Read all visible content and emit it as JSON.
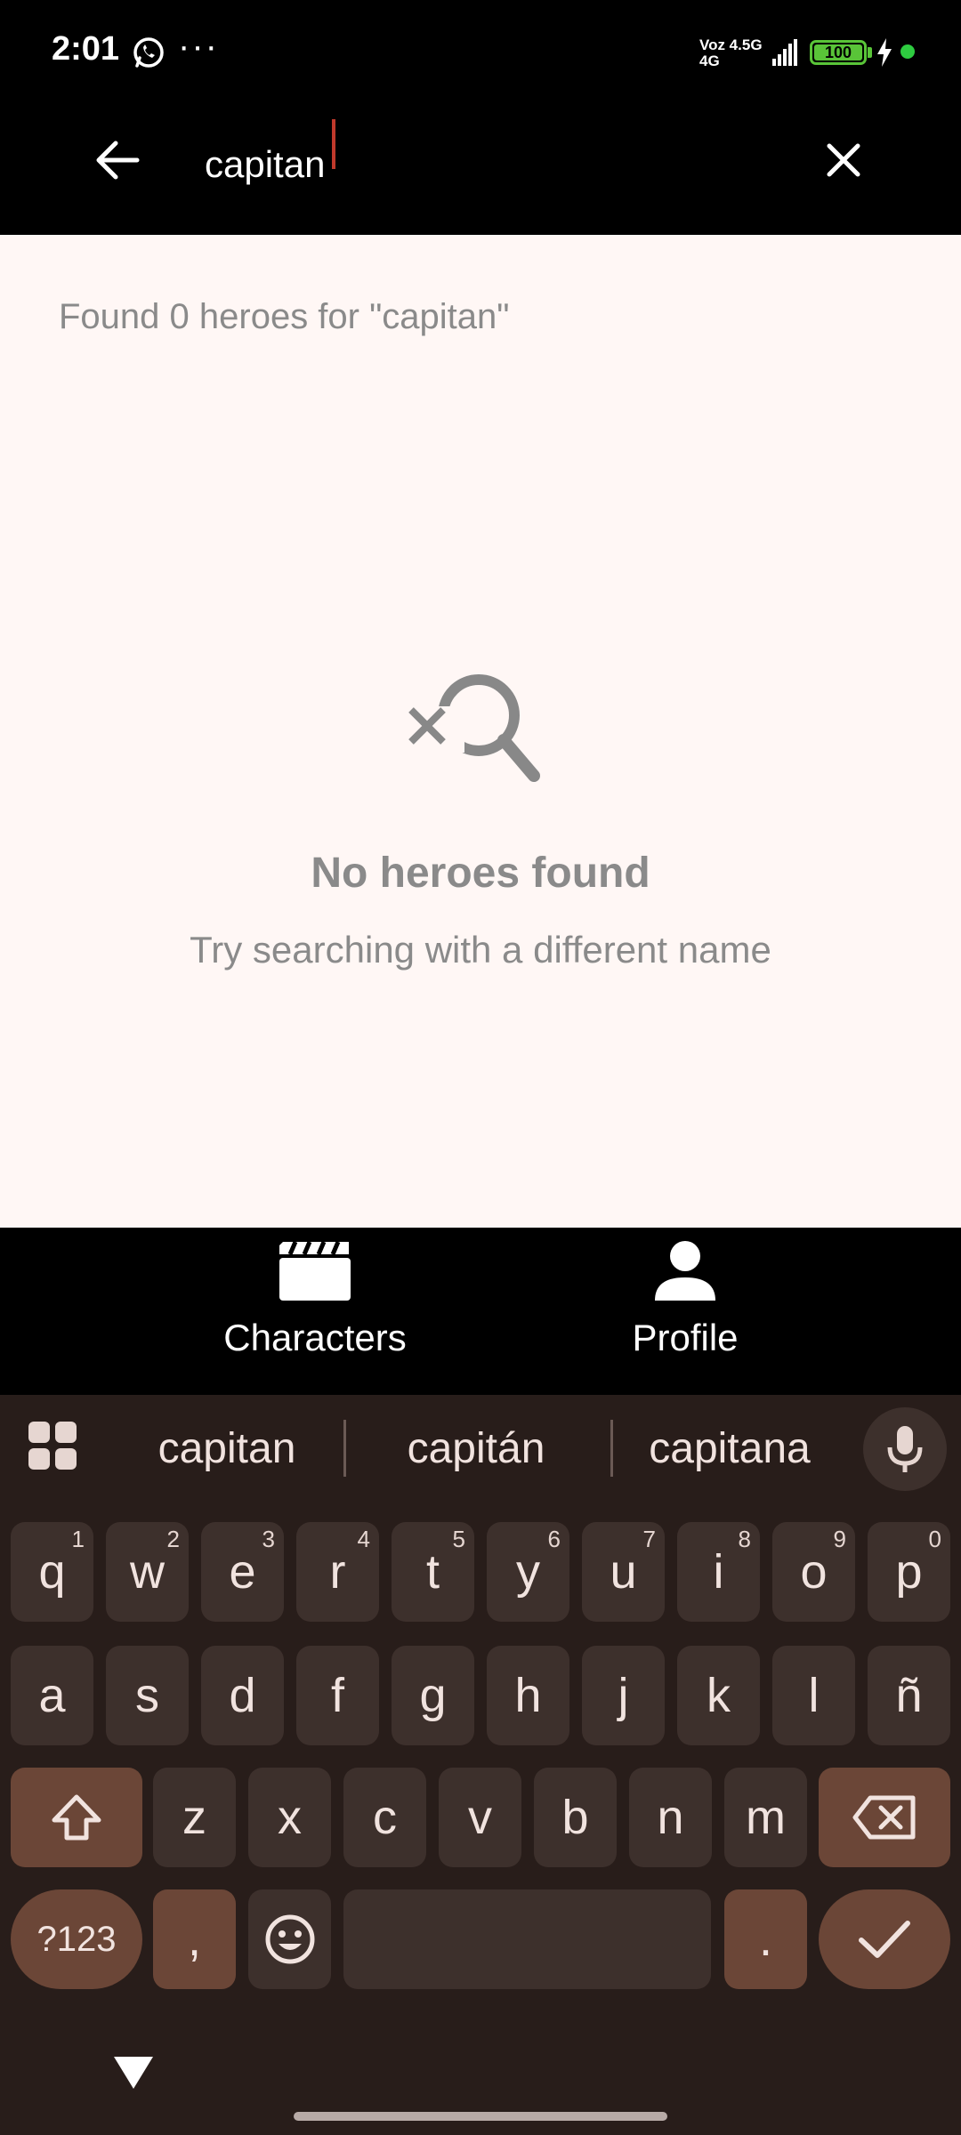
{
  "status_bar": {
    "time": "2:01",
    "dots": "···",
    "net_top": "Voz 4.5G",
    "net_bottom": "4G",
    "battery": "100"
  },
  "search": {
    "value": "capitan"
  },
  "results": {
    "count_text": "Found 0 heroes for \"capitan\"",
    "empty_title": "No heroes found",
    "empty_subtitle": "Try searching with a different name"
  },
  "bottom_nav": {
    "items": [
      {
        "label": "Characters",
        "icon": "clapperboard-icon"
      },
      {
        "label": "Profile",
        "icon": "person-icon"
      }
    ]
  },
  "keyboard": {
    "suggestions": [
      "capitan",
      "capitán",
      "capitana"
    ],
    "row1": [
      {
        "key": "q",
        "sup": "1"
      },
      {
        "key": "w",
        "sup": "2"
      },
      {
        "key": "e",
        "sup": "3"
      },
      {
        "key": "r",
        "sup": "4"
      },
      {
        "key": "t",
        "sup": "5"
      },
      {
        "key": "y",
        "sup": "6"
      },
      {
        "key": "u",
        "sup": "7"
      },
      {
        "key": "i",
        "sup": "8"
      },
      {
        "key": "o",
        "sup": "9"
      },
      {
        "key": "p",
        "sup": "0"
      }
    ],
    "row2": [
      "a",
      "s",
      "d",
      "f",
      "g",
      "h",
      "j",
      "k",
      "l",
      "ñ"
    ],
    "row3": [
      "z",
      "x",
      "c",
      "v",
      "b",
      "n",
      "m"
    ],
    "symbols_label": "?123",
    "comma": ",",
    "period": "."
  },
  "colors": {
    "content_bg": "#fff7f5",
    "keyboard_bg": "#281d1a",
    "key_bg": "#3d302c",
    "accent_key": "#6b4637",
    "muted_text": "#8a8a8a"
  }
}
